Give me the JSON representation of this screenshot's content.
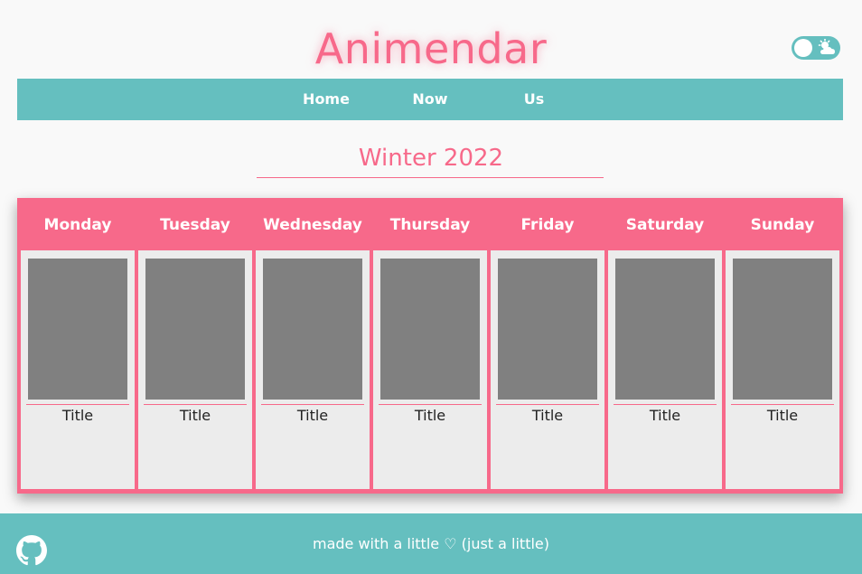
{
  "header": {
    "title": "Animendar",
    "theme_toggle_icon": "sun-cloud-icon"
  },
  "nav": {
    "items": [
      {
        "label": "Home"
      },
      {
        "label": "Now"
      },
      {
        "label": "Us"
      }
    ]
  },
  "season": {
    "label": "Winter 2022"
  },
  "calendar": {
    "days": [
      {
        "name": "Monday",
        "card_title": "Title"
      },
      {
        "name": "Tuesday",
        "card_title": "Title"
      },
      {
        "name": "Wednesday",
        "card_title": "Title"
      },
      {
        "name": "Thursday",
        "card_title": "Title"
      },
      {
        "name": "Friday",
        "card_title": "Title"
      },
      {
        "name": "Saturday",
        "card_title": "Title"
      },
      {
        "name": "Sunday",
        "card_title": "Title"
      }
    ]
  },
  "footer": {
    "text": "made with a little ♡ (just a little)",
    "icon": "github-icon"
  },
  "colors": {
    "accent_pink": "#f7698a",
    "accent_teal": "#65bfbf",
    "poster_placeholder": "#808080",
    "card_background": "#ececec"
  }
}
